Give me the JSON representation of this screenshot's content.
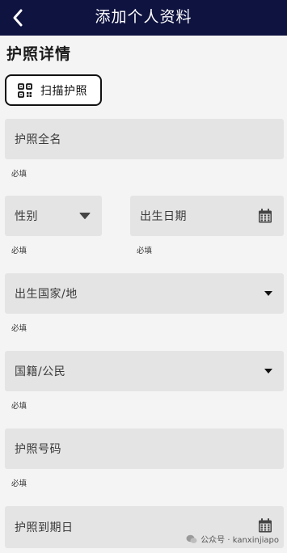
{
  "header": {
    "title": "添加个人资料"
  },
  "section": {
    "title": "护照详情"
  },
  "scan_button": {
    "label": "扫描护照"
  },
  "fields": {
    "full_name": {
      "placeholder": "护照全名",
      "hint": "必填"
    },
    "gender": {
      "placeholder": "性别",
      "hint": "必填"
    },
    "birth_date": {
      "placeholder": "出生日期",
      "hint": "必填"
    },
    "birth_country": {
      "placeholder": "出生国家/地",
      "hint": "必填"
    },
    "nationality": {
      "placeholder": "国籍/公民",
      "hint": "必填"
    },
    "passport_number": {
      "placeholder": "护照号码",
      "hint": "必填"
    },
    "passport_expiry": {
      "placeholder": "护照到期日"
    }
  },
  "watermark": {
    "text": "公众号 · kanxinjiapo"
  }
}
